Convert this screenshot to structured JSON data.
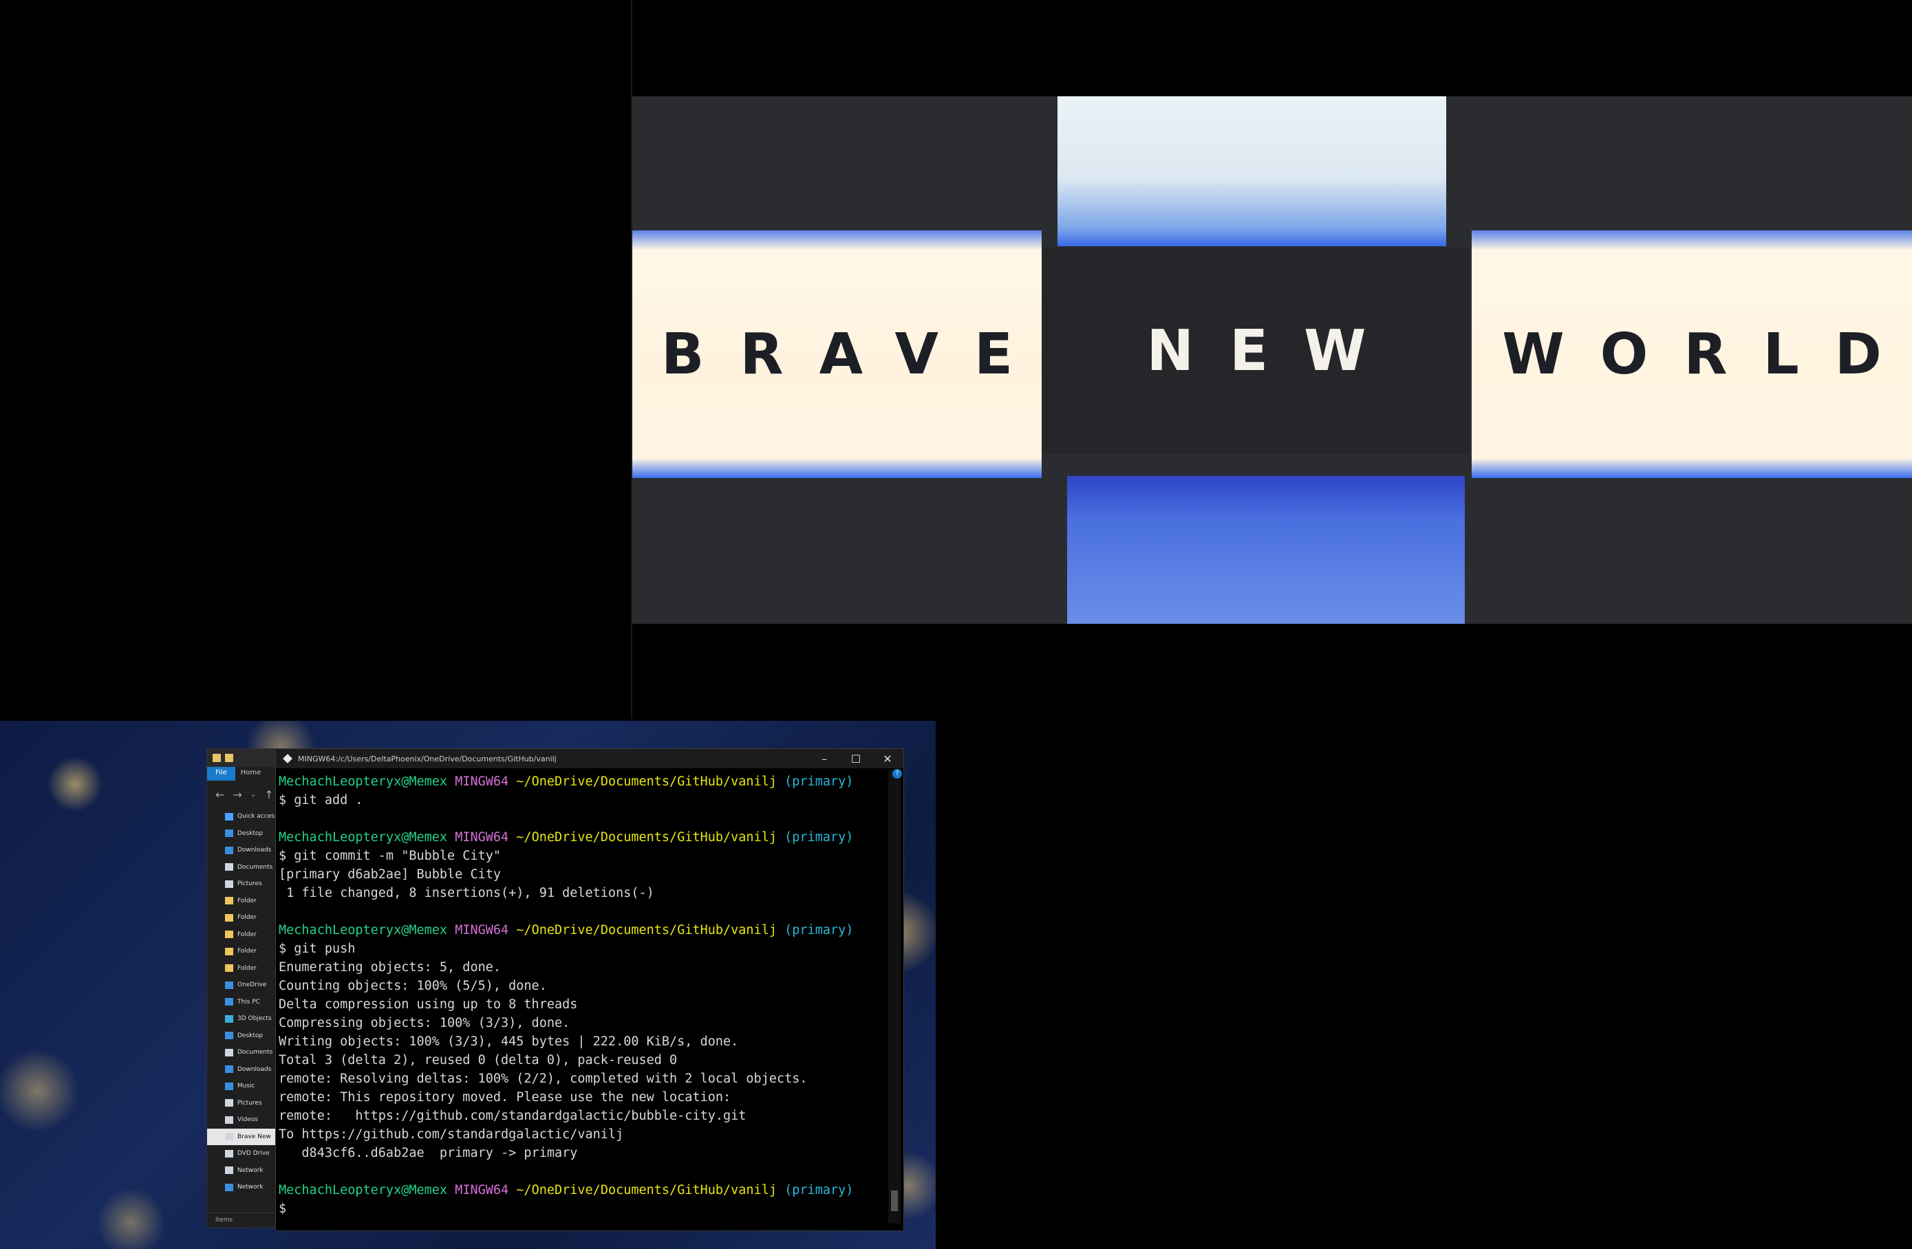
{
  "video": {
    "words": [
      "BRAVE",
      "NEW",
      "WORLD"
    ]
  },
  "explorer": {
    "ribbon_tabs": [
      "File",
      "Home"
    ],
    "nav_icons": [
      "back-arrow",
      "forward-arrow",
      "chevron-down",
      "up-arrow"
    ],
    "tree": [
      {
        "label": "Quick access",
        "icon": "star-icon",
        "color": "#4aa3ff"
      },
      {
        "label": "Desktop",
        "icon": "desktop-icon",
        "color": "#3b8fe0"
      },
      {
        "label": "Downloads",
        "icon": "download-icon",
        "color": "#3b8fe0"
      },
      {
        "label": "Documents",
        "icon": "document-icon",
        "color": "#cfd6df"
      },
      {
        "label": "Pictures",
        "icon": "picture-icon",
        "color": "#cfd6df"
      },
      {
        "label": "Folder",
        "icon": "folder-icon",
        "color": "#f1c55e"
      },
      {
        "label": "Folder",
        "icon": "folder-icon",
        "color": "#f1c55e"
      },
      {
        "label": "Folder",
        "icon": "folder-icon",
        "color": "#f1c55e"
      },
      {
        "label": "Folder",
        "icon": "folder-icon",
        "color": "#f1c55e"
      },
      {
        "label": "Folder",
        "icon": "folder-icon",
        "color": "#f1c55e"
      },
      {
        "label": "OneDrive",
        "icon": "cloud-icon",
        "color": "#3b8fe0"
      },
      {
        "label": "This PC",
        "icon": "computer-icon",
        "color": "#3b8fe0"
      },
      {
        "label": "3D Objects",
        "icon": "cube-icon",
        "color": "#3bb0e0"
      },
      {
        "label": "Desktop",
        "icon": "desktop-icon",
        "color": "#3b8fe0"
      },
      {
        "label": "Documents",
        "icon": "document-icon",
        "color": "#cfd6df"
      },
      {
        "label": "Downloads",
        "icon": "download-icon",
        "color": "#3b8fe0"
      },
      {
        "label": "Music",
        "icon": "music-icon",
        "color": "#3b8fe0"
      },
      {
        "label": "Pictures",
        "icon": "picture-icon",
        "color": "#cfd6df"
      },
      {
        "label": "Videos",
        "icon": "video-icon",
        "color": "#cfd6df"
      },
      {
        "label": "Brave New",
        "icon": "drive-icon",
        "color": "#cfd6df",
        "selected": true
      },
      {
        "label": "DVD Drive",
        "icon": "disc-icon",
        "color": "#cfd6df"
      },
      {
        "label": "Network",
        "icon": "drive-icon",
        "color": "#cfd6df"
      },
      {
        "label": "Network",
        "icon": "network-icon",
        "color": "#3b8fe0"
      }
    ],
    "status": "items"
  },
  "terminal": {
    "title": "MINGW64:/c/Users/DeltaPhoenix/OneDrive/Documents/GitHub/vanilj",
    "buttons": {
      "minimize": "–",
      "maximize": "☐",
      "close": "✕"
    },
    "prompt": {
      "user": "MechachLeopteryx@Memex",
      "env": "MINGW64",
      "path": "~/OneDrive/Documents/GitHub/vanilj",
      "branch": "(primary)"
    },
    "blocks": [
      {
        "command": "$ git add .",
        "output": []
      },
      {
        "command": "$ git commit -m \"Bubble City\"",
        "output": [
          "[primary d6ab2ae] Bubble City",
          " 1 file changed, 8 insertions(+), 91 deletions(-)"
        ]
      },
      {
        "command": "$ git push",
        "output": [
          "Enumerating objects: 5, done.",
          "Counting objects: 100% (5/5), done.",
          "Delta compression using up to 8 threads",
          "Compressing objects: 100% (3/3), done.",
          "Writing objects: 100% (3/3), 445 bytes | 222.00 KiB/s, done.",
          "Total 3 (delta 2), reused 0 (delta 0), pack-reused 0",
          "remote: Resolving deltas: 100% (2/2), completed with 2 local objects.",
          "remote: This repository moved. Please use the new location:",
          "remote:   https://github.com/standardgalactic/bubble-city.git",
          "To https://github.com/standardgalactic/vanilj",
          "   d843cf6..d6ab2ae  primary -> primary"
        ]
      }
    ],
    "final_prompt": "$"
  }
}
